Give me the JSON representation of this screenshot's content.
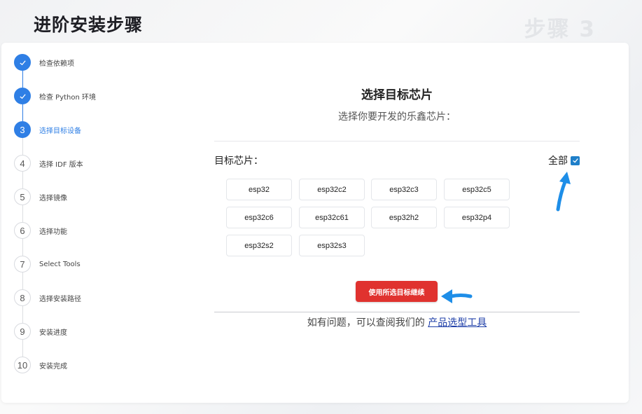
{
  "header": {
    "title": "进阶安装步骤",
    "step_watermark": "步骤 3"
  },
  "stepper": {
    "steps": [
      {
        "number": "1",
        "label": "检查依赖项",
        "state": "done"
      },
      {
        "number": "2",
        "label": "检查 Python 环境",
        "state": "done"
      },
      {
        "number": "3",
        "label": "选择目标设备",
        "state": "active"
      },
      {
        "number": "4",
        "label": "选择 IDF 版本",
        "state": "pending"
      },
      {
        "number": "5",
        "label": "选择镜像",
        "state": "pending"
      },
      {
        "number": "6",
        "label": "选择功能",
        "state": "pending"
      },
      {
        "number": "7",
        "label": "Select Tools",
        "state": "pending"
      },
      {
        "number": "8",
        "label": "选择安装路径",
        "state": "pending"
      },
      {
        "number": "9",
        "label": "安装进度",
        "state": "pending"
      },
      {
        "number": "10",
        "label": "安装完成",
        "state": "pending"
      }
    ]
  },
  "main": {
    "title": "选择目标芯片",
    "subtitle": "选择你要开发的乐鑫芯片：",
    "target_label": "目标芯片：",
    "select_all_label": "全部",
    "select_all_checked": true,
    "chips": [
      "esp32",
      "esp32c2",
      "esp32c3",
      "esp32c5",
      "esp32c6",
      "esp32c61",
      "esp32h2",
      "esp32p4",
      "esp32s2",
      "esp32s3"
    ],
    "continue_button": "使用所选目标继续",
    "help_prefix": "如有问题，可以查阅我们的 ",
    "help_link": "产品选型工具"
  },
  "colors": {
    "accent_blue": "#2f7fe5",
    "button_red": "#e0322f",
    "annotation_arrow": "#1e8ee8"
  }
}
